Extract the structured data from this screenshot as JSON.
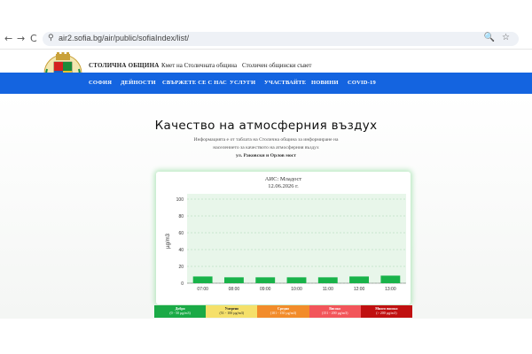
{
  "browser": {
    "back": "←",
    "forward": "→",
    "reload": "C",
    "site_info": "⚲",
    "url": "air2.sofia.bg/air/public/sofiaIndex/list/",
    "zoom": "🔍",
    "star": "☆"
  },
  "header": {
    "brand": "СТОЛИЧНА ОБЩИНА",
    "links": [
      "Кмет на Столичната община",
      "Столичен общински съвет"
    ]
  },
  "nav": {
    "items": [
      "СОФИЯ",
      "ДЕЙНОСТИ",
      "СВЪРЖЕТЕ СЕ С НАС",
      "УСЛУГИ",
      "УЧАСТВАЙТЕ",
      "НОВИНИ",
      "COVID-19"
    ]
  },
  "main": {
    "title": "Качество на атмосферния въздух",
    "subtitle_lines": [
      "Информацията е от таблата на Столична община за информиране на",
      "населението за качеството на атмосферния въздух"
    ],
    "location": "ул. Раковски и Орлов мост"
  },
  "chart_data": {
    "type": "bar",
    "title": "АИС: Младост",
    "subtitle": "12.06.2026 г.",
    "ylabel": "µg/m3",
    "xlabel": "",
    "ylim": [
      0,
      100
    ],
    "yticks": [
      0,
      20,
      40,
      60,
      80,
      100
    ],
    "grid": true,
    "categories": [
      "07:00",
      "08:00",
      "09:00",
      "10:00",
      "11:00",
      "12:00",
      "13:00"
    ],
    "values": [
      8,
      7,
      7,
      7,
      7,
      8,
      9
    ],
    "bar_color": "#19b34a"
  },
  "legend": {
    "items": [
      {
        "label": "Добро",
        "range": "(0 - 50 µg/m3)",
        "color": "#1aaa46",
        "text_color": "#ffffff"
      },
      {
        "label": "Умерено",
        "range": "(51 - 100 µg/m3)",
        "color": "#f5e06a",
        "text_color": "#222222"
      },
      {
        "label": "Средно",
        "range": "(101 - 150 µg/m3)",
        "color": "#f28c2a",
        "text_color": "#ffffff"
      },
      {
        "label": "Високо",
        "range": "(151 - 200 µg/m3)",
        "color": "#f2555a",
        "text_color": "#ffffff"
      },
      {
        "label": "Много високо",
        "range": "(> 200 µg/m3)",
        "color": "#c01010",
        "text_color": "#ffffff"
      }
    ]
  }
}
